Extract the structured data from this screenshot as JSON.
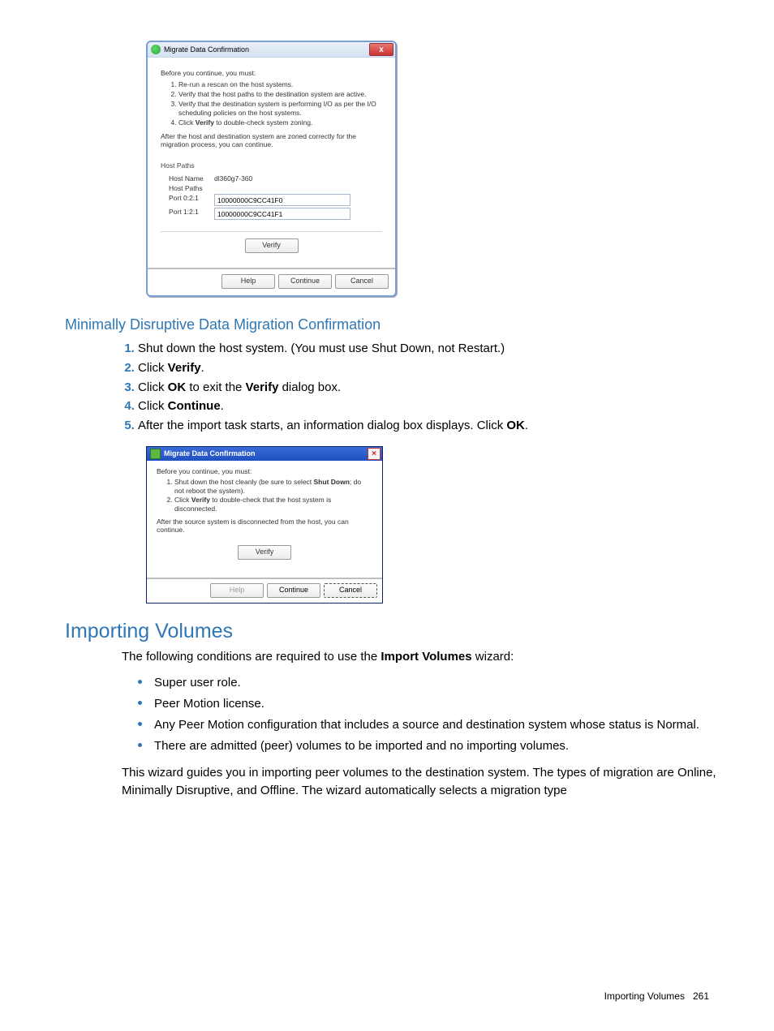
{
  "dialog1": {
    "title": "Migrate Data Confirmation",
    "intro": "Before you continue, you must:",
    "steps": {
      "s1": "Re-run a rescan on the host systems.",
      "s2": "Verify that the host paths to the destination system are active.",
      "s3": "Verify that the destination system is performing I/O as per the I/O scheduling policies on the host systems.",
      "s4_pre": "Click ",
      "s4_bold": "Verify",
      "s4_post": " to double-check system zoning."
    },
    "after": "After the host and destination system are zoned correctly for the migration process, you can continue.",
    "hostpaths_label": "Host Paths",
    "hostname_label": "Host Name",
    "hostname_value": "dl360g7-360",
    "hostpaths_sublabel": "Host Paths",
    "port0_label": "Port 0:2:1",
    "port0_value": "10000000C9CC41F0",
    "port1_label": "Port 1:2:1",
    "port1_value": "10000000C9CC41F1",
    "verify_btn": "Verify",
    "help_btn": "Help",
    "continue_btn": "Continue",
    "cancel_btn": "Cancel"
  },
  "section1": {
    "heading": "Minimally Disruptive Data Migration Confirmation",
    "li1": "Shut down the host system. (You must use Shut Down, not Restart.)",
    "li2_pre": "Click ",
    "li2_bold": "Verify",
    "li2_post": ".",
    "li3_pre": "Click ",
    "li3_bold": "OK",
    "li3_mid": " to exit the ",
    "li3_bold2": "Verify",
    "li3_post": " dialog box.",
    "li4_pre": "Click ",
    "li4_bold": "Continue",
    "li4_post": ".",
    "li5_pre": "After the import task starts, an information dialog box displays. Click ",
    "li5_bold": "OK",
    "li5_post": "."
  },
  "dialog2": {
    "title": "Migrate Data Confirmation",
    "intro": "Before you continue, you must:",
    "s1_pre": "Shut down the host cleanly (be sure to select ",
    "s1_bold": "Shut Down",
    "s1_post": "; do not reboot the system).",
    "s2_pre": "Click ",
    "s2_bold": "Verify",
    "s2_post": " to double-check that the host system is disconnected.",
    "after": "After the source system is disconnected from the host, you can continue.",
    "verify_btn": "Verify",
    "help_btn": "Help",
    "continue_btn": "Continue",
    "cancel_btn": "Cancel"
  },
  "section2": {
    "heading": "Importing Volumes",
    "intro_pre": "The following conditions are required to use the ",
    "intro_bold": "Import Volumes",
    "intro_post": " wizard:",
    "b1": "Super user role.",
    "b2": "Peer Motion license.",
    "b3": "Any Peer Motion configuration that includes a source and destination system whose status is Normal.",
    "b4": "There are admitted (peer) volumes to be imported and no importing volumes.",
    "para": "This wizard guides you in importing peer volumes to the destination system. The types of migration are Online, Minimally Disruptive, and Offline. The wizard automatically selects a migration type"
  },
  "footer": {
    "label": "Importing Volumes",
    "page": "261"
  }
}
